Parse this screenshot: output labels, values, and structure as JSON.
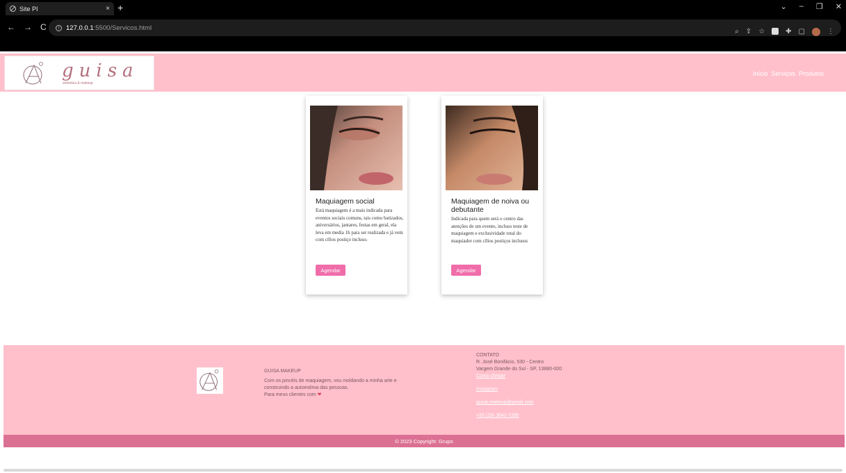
{
  "browser": {
    "tab_title": "Site PI",
    "tab_close": "×",
    "new_tab": "+",
    "url_host": "127.0.0.1",
    "url_rest": ":5500/Servicos.html",
    "back": "←",
    "forward": "→",
    "reload": "C",
    "win_min": "–",
    "win_restore": "❐",
    "win_close": "✕",
    "win_menu": "⌄"
  },
  "header": {
    "logo_text": "guisa",
    "logo_sub": "esthetica & makeup",
    "nav": [
      {
        "label": "Início"
      },
      {
        "label": "Serviços"
      },
      {
        "label": "Produtos"
      }
    ]
  },
  "cards": [
    {
      "title": "Maquiagem social",
      "text": "Está maquiagem é a mais indicada para eventos sociais comuns, tais como batizados, aniversários, jantares, festas em geral, ela leva em media 1h para ser realizada e já vem com cílios postiço incluso.",
      "button": "Agendar"
    },
    {
      "title": "Maquiagem de noiva ou debutante",
      "text": "Indicada para quem será o centro das atenções de um evento, incluso teste de maquiagem e exclusividade total do maquiador com cílios postiços inclusos",
      "button": "Agendar"
    }
  ],
  "footer": {
    "brand": "GUISA MAKEUP",
    "about": "Com os pincéis de maquiagem, vou moldando a minha arte e construindo a autoestima das pessoas.",
    "clients": "Para meus clientes com",
    "contact_title": "CONTATO",
    "address_1": "R. José Bonifácio, 530 - Centro",
    "address_2": "Vargem Grande do Sul - SP, 13880-000",
    "directions": "Como chegar",
    "instagram": "Instagram",
    "email": "guisa.makeup@gmail.com",
    "phone": "+55 (19) 3641-7285",
    "copyright": "© 2023 Copyright: Grupo"
  },
  "colors": {
    "pink": "#ffc0cb",
    "button": "#f06daa",
    "copyright_bar": "#db7093"
  }
}
